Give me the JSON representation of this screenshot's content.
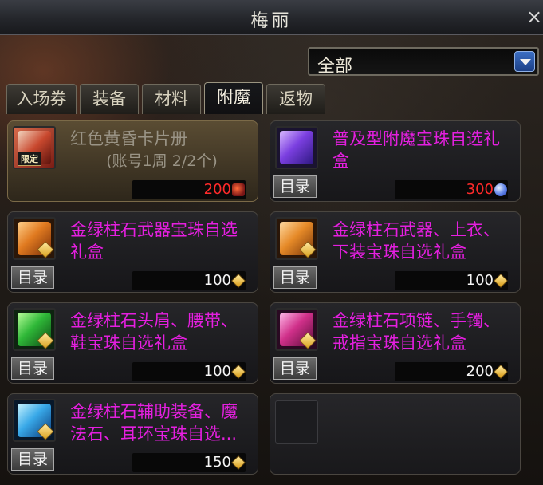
{
  "window": {
    "title": "梅丽",
    "close_label": "×"
  },
  "filter": {
    "selected": "全部"
  },
  "tabs": [
    {
      "label": "入场券"
    },
    {
      "label": "装备"
    },
    {
      "label": "材料"
    },
    {
      "label": "附魔",
      "active": true
    },
    {
      "label": "返物"
    }
  ],
  "items": [
    {
      "name": "红色黄昏卡片册",
      "sub": "(账号1周 2/2个)",
      "price": "200",
      "badge": "限定",
      "catalog": ""
    },
    {
      "name": "普及型附魔宝珠自选礼盒",
      "price": "300",
      "catalog": "目录"
    },
    {
      "name": "金绿柱石武器宝珠自选礼盒",
      "price": "100",
      "catalog": "目录"
    },
    {
      "name": "金绿柱石武器、上衣、下装宝珠自选礼盒",
      "price": "100",
      "catalog": "目录"
    },
    {
      "name": "金绿柱石头肩、腰带、鞋宝珠自选礼盒",
      "price": "100",
      "catalog": "目录"
    },
    {
      "name": "金绿柱石项链、手镯、戒指宝珠自选礼盒",
      "price": "200",
      "catalog": "目录"
    },
    {
      "name": "金绿柱石辅助装备、魔法石、耳环宝珠自选...",
      "price": "150",
      "catalog": "目录"
    }
  ],
  "colors": {
    "item_name": "#e51fe0",
    "price_red": "#ff2a2a",
    "price_white": "#f5f5f5",
    "accent_blue": "#3c6fc4"
  },
  "icons": [
    "card-album-icon",
    "blue-orb-box-icon",
    "orange-orb-box-icon",
    "orange-orb-box-icon",
    "green-orb-box-icon",
    "pink-orb-box-icon",
    "cyan-orb-box-icon",
    "gold-coin-icon",
    "crystal-coin-icon"
  ]
}
